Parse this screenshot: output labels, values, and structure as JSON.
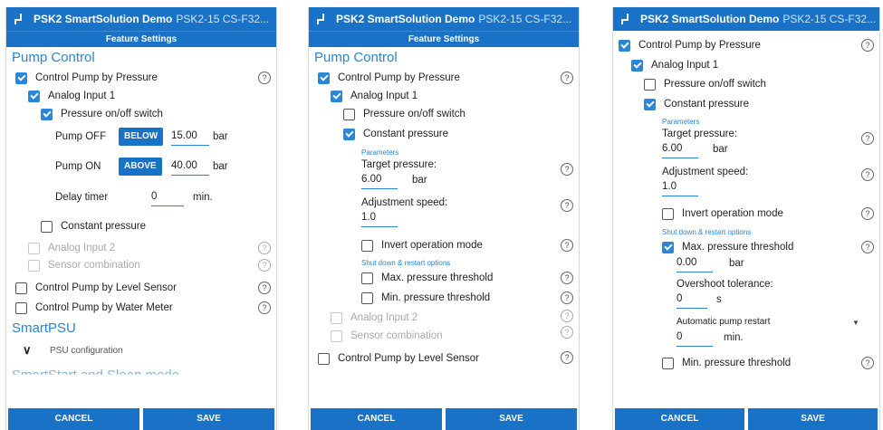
{
  "app": {
    "title": "PSK2 SmartSolution Demo",
    "device": "PSK2-15 CS-F32...",
    "device_short": "PSK2-15 CS-F32..."
  },
  "header": {
    "subtitle": "Feature Settings"
  },
  "footer": {
    "cancel": "CANCEL",
    "save": "SAVE"
  },
  "help_glyph": "?",
  "panel1": {
    "section_pump": "Pump Control",
    "control_pressure": "Control Pump by Pressure",
    "analog1": "Analog Input 1",
    "pressure_switch": "Pressure on/off switch",
    "pump_off": {
      "label": "Pump OFF",
      "mode": "BELOW",
      "value": "15.00",
      "unit": "bar"
    },
    "pump_on": {
      "label": "Pump ON",
      "mode": "ABOVE",
      "value": "40.00",
      "unit": "bar"
    },
    "delay": {
      "label": "Delay timer",
      "value": "0",
      "unit": "min."
    },
    "constant_pressure": "Constant pressure",
    "analog2": "Analog Input 2",
    "sensor_combination": "Sensor combination",
    "level_sensor": "Control Pump by Level Sensor",
    "water_meter": "Control Pump by Water Meter",
    "section_psu": "SmartPSU",
    "psu_config": "PSU configuration",
    "section_cut": "SmartStart and Sleep mode"
  },
  "panel2": {
    "section_pump": "Pump Control",
    "control_pressure": "Control Pump by Pressure",
    "analog1": "Analog Input 1",
    "pressure_switch": "Pressure on/off switch",
    "constant_pressure": "Constant pressure",
    "parameters": "Parameters",
    "target_label": "Target pressure:",
    "target_value": "6.00",
    "target_unit": "bar",
    "adjust_label": "Adjustment speed:",
    "adjust_value": "1.0",
    "invert": "Invert operation mode",
    "shutdown": "Shut down & restart options",
    "max_threshold": "Max. pressure threshold",
    "min_threshold": "Min. pressure threshold",
    "analog2": "Analog Input 2",
    "sensor_combination": "Sensor combination",
    "level_sensor": "Control Pump by Level Sensor"
  },
  "panel3": {
    "control_pressure": "Control Pump by Pressure",
    "analog1": "Analog Input 1",
    "pressure_switch": "Pressure on/off switch",
    "constant_pressure": "Constant pressure",
    "parameters": "Parameters",
    "target_label": "Target pressure:",
    "target_value": "6.00",
    "target_unit": "bar",
    "adjust_label": "Adjustment speed:",
    "adjust_value": "1.0",
    "invert": "Invert operation mode",
    "shutdown": "Shut down & restart options",
    "max_threshold": "Max. pressure threshold",
    "max_value": "0.00",
    "max_unit": "bar",
    "overshoot_label": "Overshoot tolerance:",
    "overshoot_value": "0",
    "overshoot_unit": "s",
    "auto_restart": "Automatic pump restart",
    "restart_value": "0",
    "restart_unit": "min.",
    "min_threshold": "Min. pressure threshold"
  }
}
